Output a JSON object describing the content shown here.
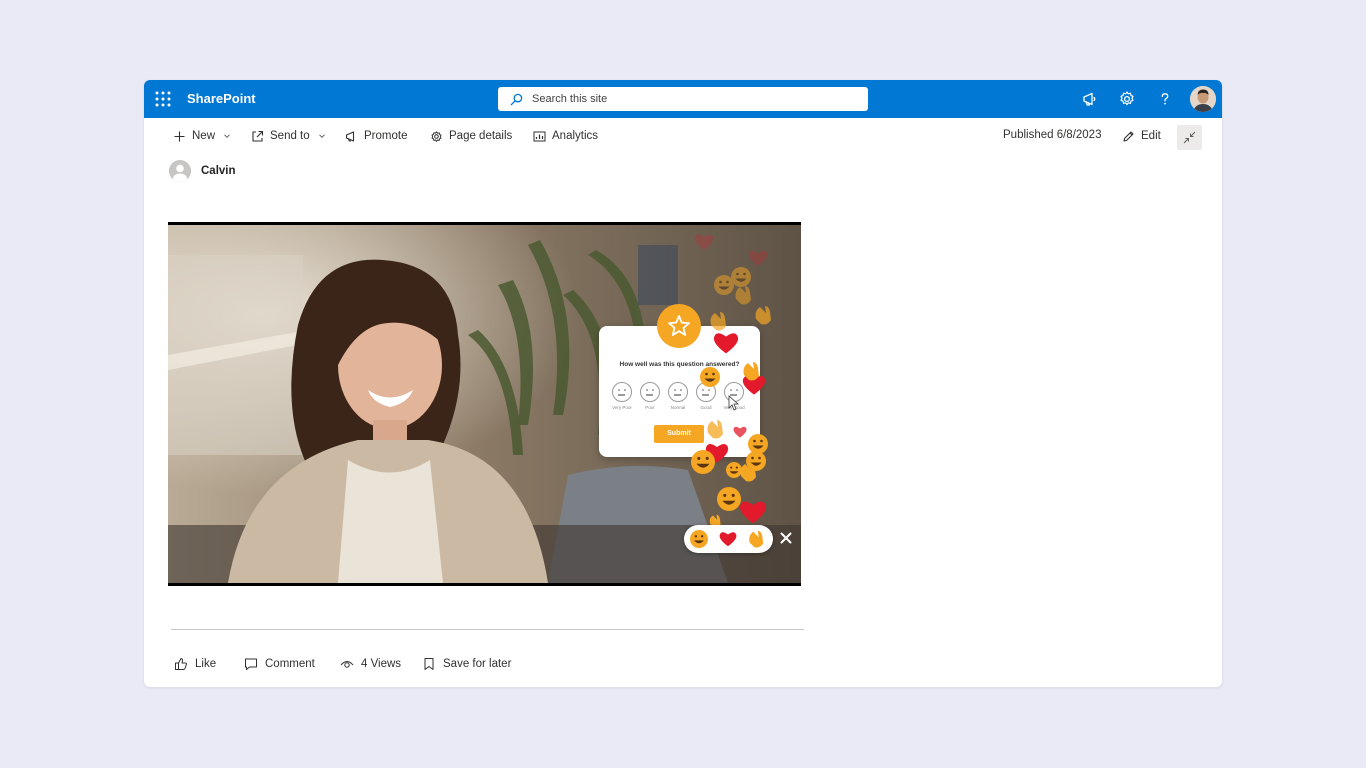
{
  "suite_bar": {
    "app_name": "SharePoint",
    "search_placeholder": "Search this site",
    "brand_color": "#0078d4",
    "icons": [
      "waffle-icon",
      "megaphone-icon",
      "gear-icon",
      "help-icon",
      "user-avatar"
    ]
  },
  "command_bar": {
    "new_label": "New",
    "send_to_label": "Send to",
    "promote_label": "Promote",
    "page_details_label": "Page details",
    "analytics_label": "Analytics",
    "published": "Published 6/8/2023",
    "edit_label": "Edit"
  },
  "author": {
    "name": "Calvin"
  },
  "video": {
    "poll": {
      "question": "How well was this question answered?",
      "ratings": [
        "Very Poor",
        "Poor",
        "Normal",
        "Good",
        "Very Good"
      ],
      "submit_label": "Submit",
      "accent_color": "#f5a623"
    },
    "reactions": [
      "grinning-face",
      "red-heart",
      "clapping-hands"
    ]
  },
  "social_bar": {
    "like_label": "Like",
    "comment_label": "Comment",
    "views_label": "4 Views",
    "save_label": "Save for later"
  }
}
